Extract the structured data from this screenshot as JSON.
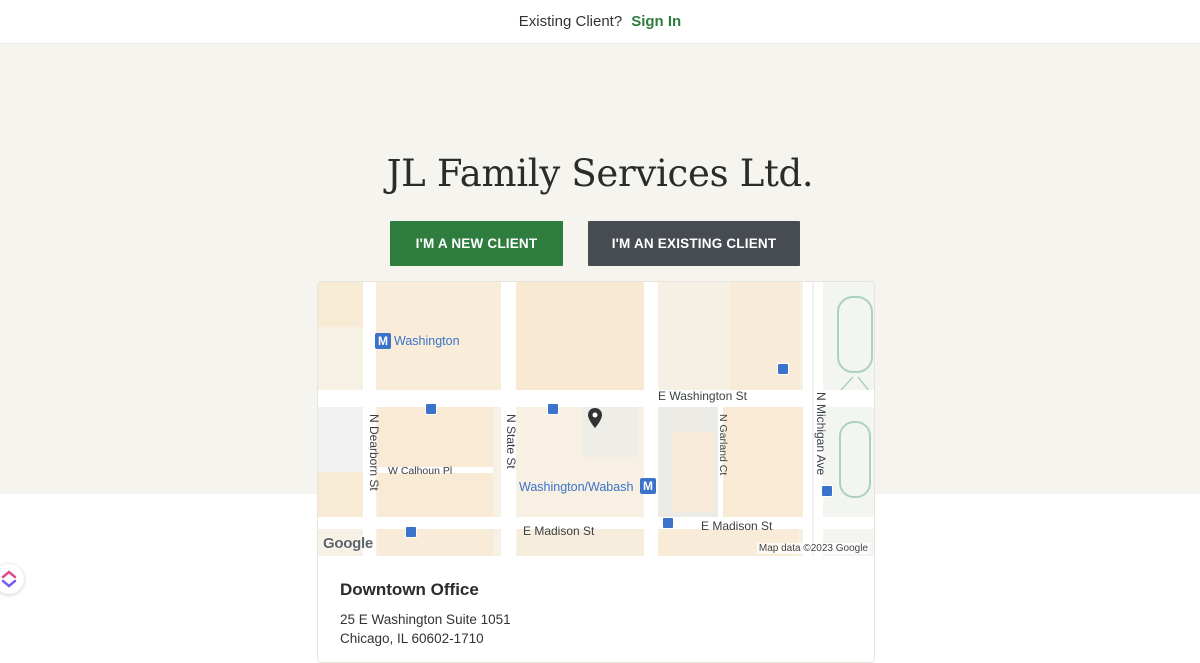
{
  "topbar": {
    "question": "Existing Client?",
    "signin_label": "Sign In"
  },
  "hero": {
    "title": "JL Family Services Ltd.",
    "new_client_label": "I'M A NEW CLIENT",
    "existing_client_label": "I'M AN EXISTING CLIENT"
  },
  "map": {
    "streets": {
      "e_washington": "E Washington St",
      "e_madison_left": "E Madison St",
      "e_madison_right": "E Madison St",
      "n_dearborn": "N Dearborn St",
      "n_state": "N State St",
      "n_garland": "N Garland Ct",
      "n_michigan": "N Michigan Ave",
      "w_calhoun": "W Calhoun Pl"
    },
    "stations": {
      "washington": "Washington",
      "washington_wabash": "Washington/Wabash"
    },
    "metro_symbol": "M",
    "google_logo": "Google",
    "attribution": "Map data ©2023 Google"
  },
  "office": {
    "name": "Downtown Office",
    "address_line1": "25 E Washington Suite 1051",
    "address_line2": "Chicago, IL 60602-1710"
  },
  "colors": {
    "brand_green": "#2f7d3e",
    "dark_button": "#474b52",
    "hero_bg": "#f5f4ee",
    "metro_blue": "#3a73c9"
  }
}
